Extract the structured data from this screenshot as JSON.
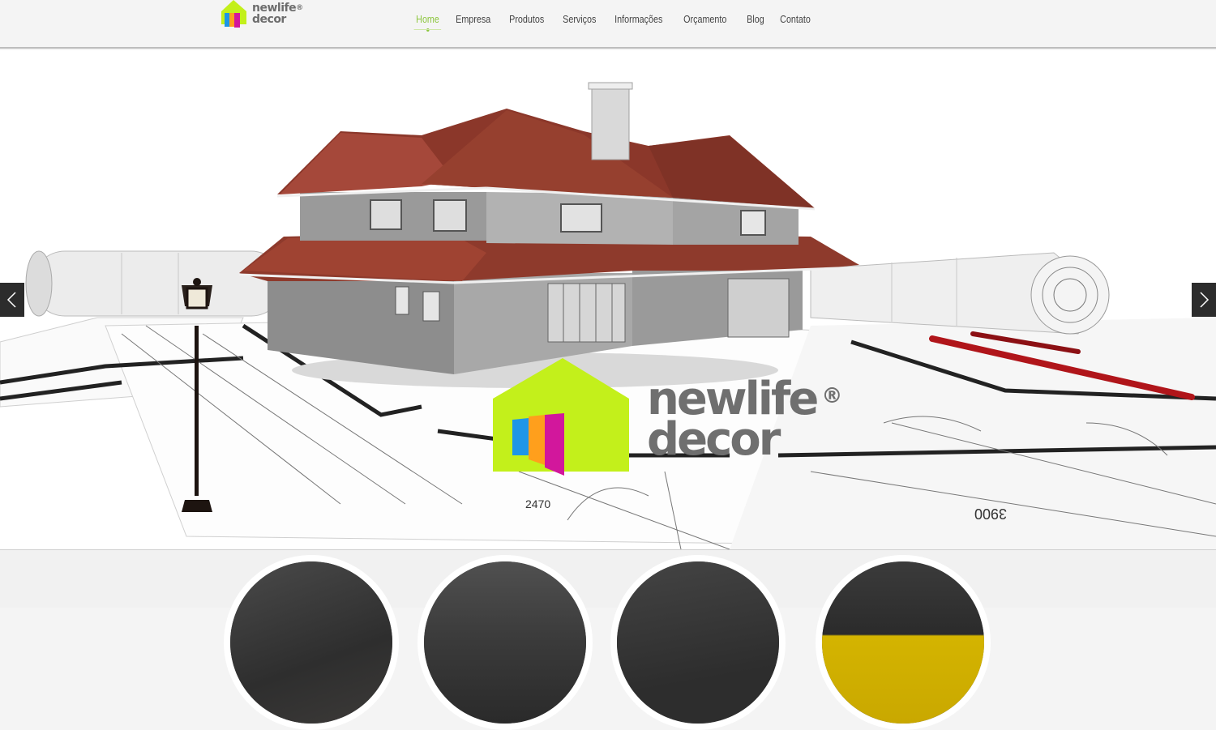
{
  "brand": {
    "name_line1": "newlife",
    "name_line2": "decor",
    "registered": "®",
    "accent_color": "#8dc63f",
    "logo_green": "#c3f01b",
    "logo_blue": "#1e96e6",
    "logo_orange": "#ff9f1c",
    "logo_magenta": "#d2179c"
  },
  "nav": {
    "items": [
      {
        "label": "Home",
        "active": true
      },
      {
        "label": "Empresa",
        "active": false
      },
      {
        "label": "Produtos",
        "active": false
      },
      {
        "label": "Serviços",
        "active": false
      },
      {
        "label": "Informações",
        "active": false
      },
      {
        "label": "Orçamento",
        "active": false
      },
      {
        "label": "Blog",
        "active": false
      },
      {
        "label": "Contato",
        "active": false
      }
    ]
  },
  "slider": {
    "prev_icon": "chevron-left-icon",
    "next_icon": "chevron-right-icon",
    "blueprint_numbers": [
      "2470",
      "3900"
    ]
  },
  "featured": {
    "items": [
      {
        "icon": "thumbnail-image"
      },
      {
        "icon": "thumbnail-image"
      },
      {
        "icon": "thumbnail-image"
      },
      {
        "icon": "thumbnail-image"
      }
    ]
  }
}
